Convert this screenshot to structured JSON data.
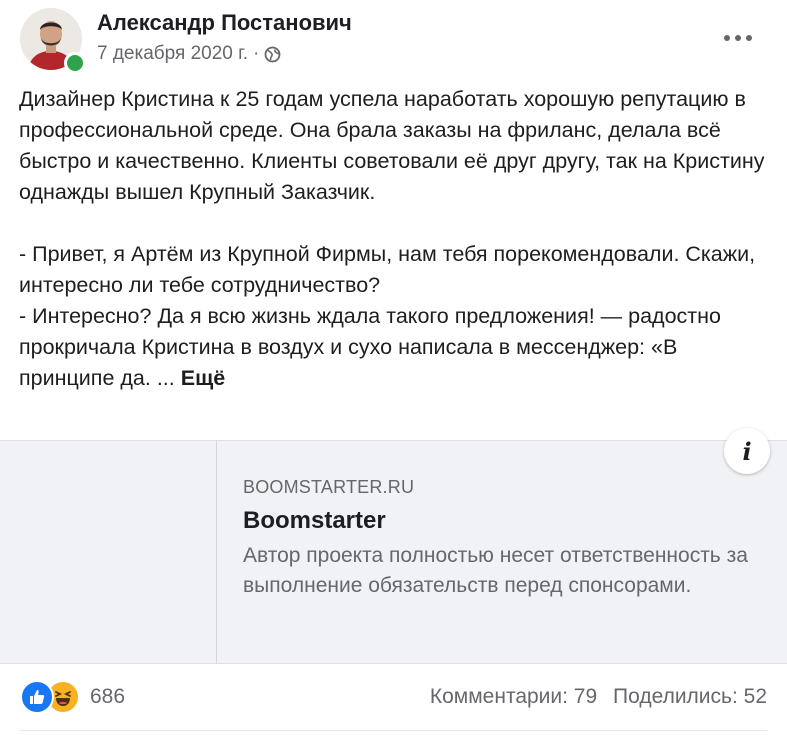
{
  "post": {
    "author": "Александр Постанович",
    "date": "7 декабря 2020 г.",
    "separator": "·",
    "privacy_icon": "globe-icon",
    "more_icon": "more-horizontal-icon",
    "paragraph1": "Дизайнер Кристина к 25 годам успела наработать хорошую репутацию в профессиональной среде. Она брала заказы на фриланс, делала всё быстро и качественно. Клиенты советовали её друг другу, так на Кристину однажды вышел Крупный Заказчик.",
    "paragraph2_line1": "- Привет, я Артём из Крупной Фирмы, нам тебя порекомендовали. Скажи, интересно ли тебе сотрудничество?",
    "paragraph2_line2": "- Интересно? Да я всю жизнь ждала такого предложения! — радостно прокричала Кристина в воздух и сухо написала в мессенджер: «В принципе да. ...",
    "see_more": "Ещё"
  },
  "link_preview": {
    "domain": "BOOMSTARTER.RU",
    "title": "Boomstarter",
    "description": "Автор проекта полностью несет ответственность за выполнение обязательств перед спонсорами.",
    "info_icon": "i"
  },
  "footer": {
    "reaction_icons": [
      "like-icon",
      "haha-icon"
    ],
    "reaction_count": "686",
    "comments": "Комментарии: 79",
    "shares": "Поделились: 52"
  },
  "colors": {
    "online": "#31a24c",
    "like": "#1877f2",
    "haha": "#f7b125",
    "secondary_text": "#65676b",
    "card_bg": "#f0f2f5"
  }
}
